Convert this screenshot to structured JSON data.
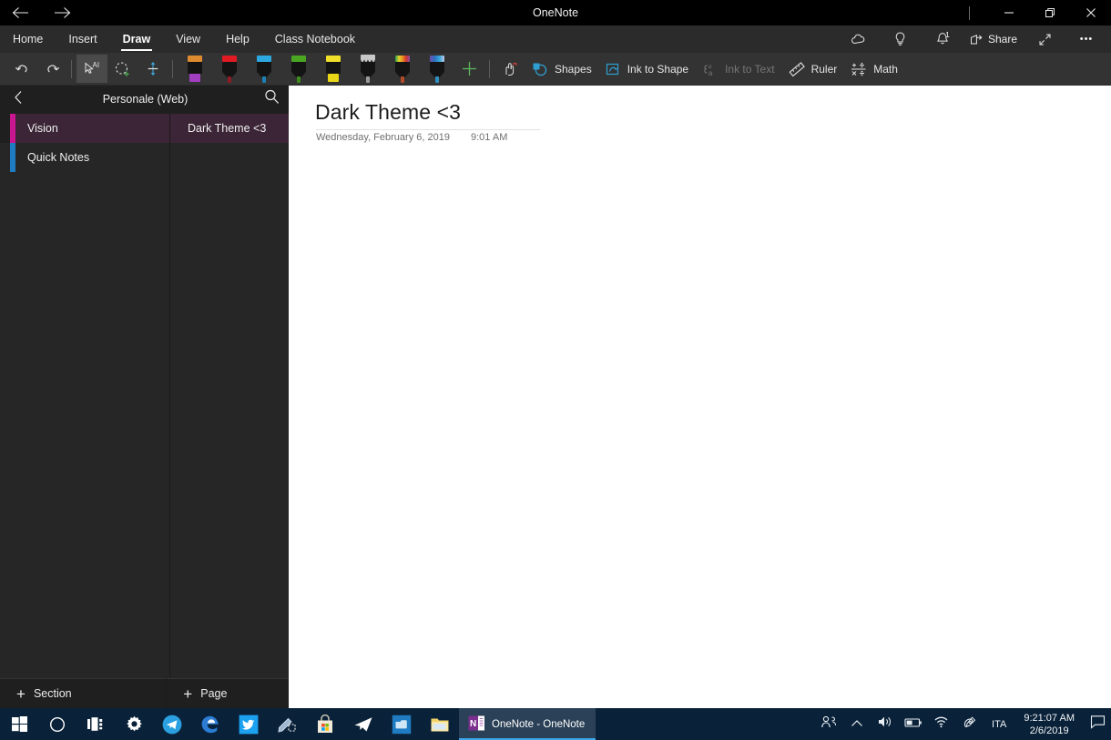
{
  "window": {
    "title": "OneNote",
    "back_icon": "arrow-left-icon",
    "forward_icon": "arrow-right-icon",
    "minimize_label": "Minimize",
    "restore_label": "Restore",
    "close_label": "Close"
  },
  "ribbon": {
    "tabs": [
      {
        "label": "Home",
        "active": false
      },
      {
        "label": "Insert",
        "active": false
      },
      {
        "label": "Draw",
        "active": true
      },
      {
        "label": "View",
        "active": false
      },
      {
        "label": "Help",
        "active": false
      },
      {
        "label": "Class Notebook",
        "active": false
      }
    ],
    "right_actions": [
      {
        "name": "sync-cloud-icon",
        "label": ""
      },
      {
        "name": "tell-me-lightbulb-icon",
        "label": ""
      },
      {
        "name": "notifications-bell-icon",
        "label": "",
        "badge": "1"
      },
      {
        "name": "share-button",
        "label": "Share"
      },
      {
        "name": "expand-icon",
        "label": ""
      },
      {
        "name": "more-options-icon",
        "label": "•••"
      }
    ],
    "tools": {
      "undo": "Undo",
      "redo": "Redo",
      "select_ink_text": "Select Ink or Text",
      "lasso_select": "Lasso Select",
      "eraser": "Eraser",
      "add_pen": "Add Pen",
      "shapes": "Shapes",
      "ink_to_shape": "Ink to Shape",
      "ink_to_text": "Ink to Text",
      "ruler": "Ruler",
      "math": "Math"
    },
    "pens": [
      {
        "name": "highlighter-purple",
        "type": "highlighter",
        "cap": "#dd8b2e",
        "tip": "#a13fc0"
      },
      {
        "name": "pen-red",
        "type": "pen",
        "cap": "#e01b24",
        "tip": "#8e1b25"
      },
      {
        "name": "pen-blue",
        "type": "pen",
        "cap": "#2ea8e0",
        "tip": "#1d7fb5"
      },
      {
        "name": "pen-green",
        "type": "pen",
        "cap": "#4aa522",
        "tip": "#3d8a1c"
      },
      {
        "name": "highlighter-yellow",
        "type": "highlighter",
        "cap": "#f0e02a",
        "tip": "#e8d617"
      },
      {
        "name": "pencil-gray",
        "type": "pencil",
        "cap": "#c9c9c9",
        "tip": "#9a9a9a"
      },
      {
        "name": "pen-rainbow",
        "type": "pen",
        "cap": "rainbow",
        "tip": "#b04b2a"
      },
      {
        "name": "pen-galaxy",
        "type": "pen",
        "cap": "galaxy",
        "tip": "#2f8fc0"
      }
    ],
    "ink_to_text_disabled": true
  },
  "navigation": {
    "notebook_name": "Personale (Web)",
    "back_icon": "chevron-left-icon",
    "search_icon": "search-icon",
    "sections": [
      {
        "label": "Vision",
        "accent": "#c7168f",
        "selected": true
      },
      {
        "label": "Quick Notes",
        "accent": "#1f7cc2",
        "selected": false
      }
    ],
    "pages": [
      {
        "label": "Dark Theme <3",
        "selected": true
      }
    ],
    "add_section_label": "Section",
    "add_page_label": "Page",
    "add_icon": "plus-icon"
  },
  "page": {
    "title": "Dark Theme <3",
    "date": "Wednesday, February 6, 2019",
    "time": "9:01 AM"
  },
  "taskbar": {
    "items": [
      {
        "name": "start-button",
        "icon": "windows-logo-icon"
      },
      {
        "name": "cortana-search-button",
        "icon": "circle-icon"
      },
      {
        "name": "task-view-button",
        "icon": "task-view-icon"
      },
      {
        "name": "settings-app",
        "icon": "gear-icon"
      },
      {
        "name": "telegram-app",
        "icon": "telegram-icon"
      },
      {
        "name": "microsoft-edge-app",
        "icon": "edge-icon"
      },
      {
        "name": "twitter-app",
        "icon": "twitter-icon"
      },
      {
        "name": "snip-sketch-app",
        "icon": "snip-icon"
      },
      {
        "name": "microsoft-store-app",
        "icon": "store-icon"
      },
      {
        "name": "telegram-desktop-app",
        "icon": "paper-plane-icon"
      },
      {
        "name": "photos-app",
        "icon": "photos-icon"
      },
      {
        "name": "file-explorer-app",
        "icon": "folder-icon"
      }
    ],
    "active_app": {
      "label": "OneNote - OneNote",
      "icon": "onenote-icon"
    },
    "tray": {
      "people_icon": "people-icon",
      "chevron_icon": "chevron-up-icon",
      "volume_icon": "speaker-icon",
      "battery_icon": "battery-icon",
      "wifi_icon": "wifi-icon",
      "pen_workspace_icon": "ink-workspace-icon",
      "language": "ITA",
      "time": "9:21:07 AM",
      "date": "2/6/2019",
      "notification_icon": "action-center-icon"
    }
  }
}
